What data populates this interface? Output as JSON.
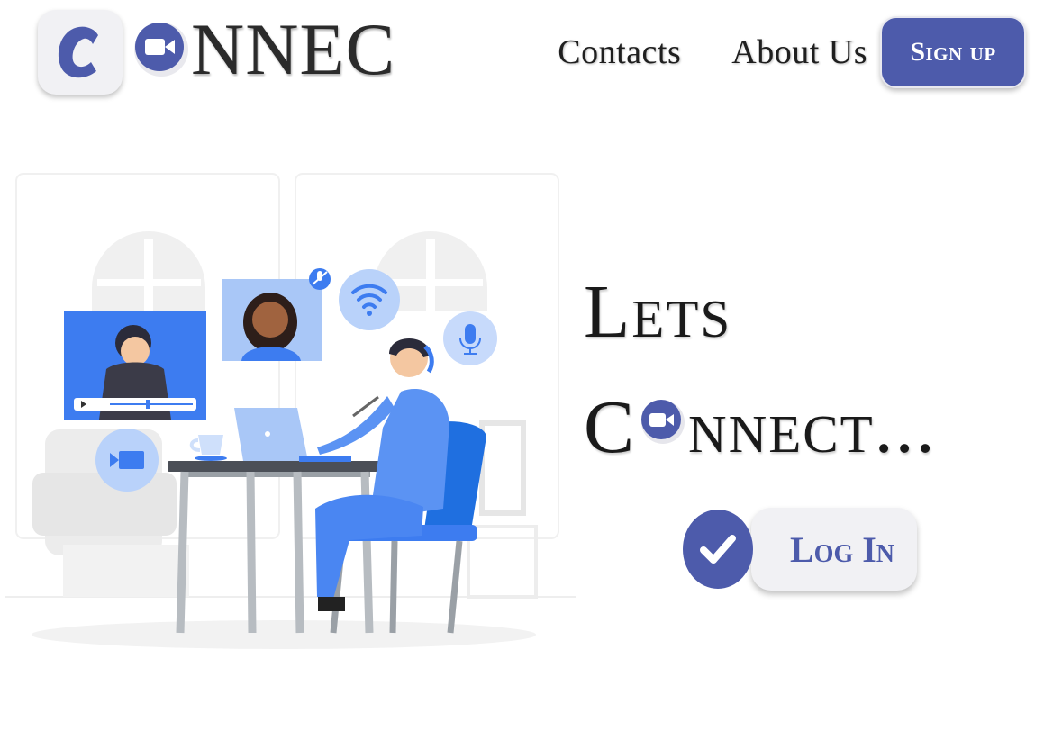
{
  "header": {
    "logo_text": "NNEC",
    "nav": {
      "contacts": "Contacts",
      "about": "About Us",
      "signup": "Sign up"
    }
  },
  "hero": {
    "line1": "Lets",
    "line2_start": "C",
    "line2_end": "nnect...",
    "login_label": "Log In"
  },
  "icons": {
    "logo_letter": "c-letter-icon",
    "camera": "video-camera-icon",
    "check": "checkmark-icon"
  },
  "colors": {
    "brand": "#4d5bab",
    "tile": "#f1f1f4",
    "illustration_blue": "#3d7cf0"
  }
}
